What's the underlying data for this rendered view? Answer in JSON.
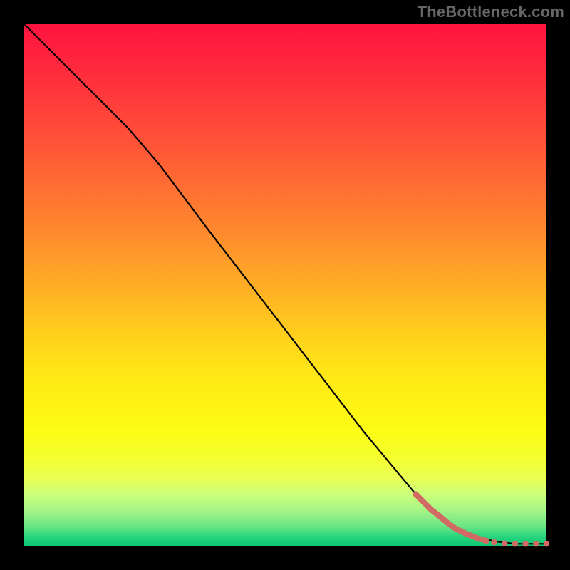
{
  "watermark": "TheBottleneck.com",
  "chart_data": {
    "type": "line",
    "title": "",
    "xlabel": "",
    "ylabel": "",
    "xlim": [
      0,
      100
    ],
    "ylim": [
      0,
      100
    ],
    "grid": false,
    "series": [
      {
        "name": "curve",
        "style": "black-line",
        "x": [
          0,
          10,
          20,
          26,
          35,
          45,
          55,
          65,
          75,
          82,
          86,
          90,
          94,
          100
        ],
        "y": [
          100,
          90,
          80,
          73,
          61,
          48,
          35,
          22,
          10,
          4,
          2,
          1,
          0.5,
          0.5
        ]
      }
    ],
    "scatter": [
      {
        "name": "highlight-tail",
        "color": "#d16a63",
        "x": [
          75,
          76.5,
          78,
          79.3,
          80.5,
          81.5,
          82.5,
          83.5,
          84.5,
          85.5,
          87,
          88.5,
          90,
          92,
          94,
          96,
          98,
          100
        ],
        "y": [
          10,
          8.5,
          7,
          6,
          5,
          4.2,
          3.5,
          3,
          2.5,
          2.1,
          1.5,
          1.1,
          0.8,
          0.6,
          0.5,
          0.5,
          0.5,
          0.5
        ]
      }
    ],
    "background_gradient": {
      "top": "#ff133f",
      "mid": [
        "#ff8a2e",
        "#ffee14",
        "#fcfc15"
      ],
      "bottom": "#09c574"
    }
  }
}
